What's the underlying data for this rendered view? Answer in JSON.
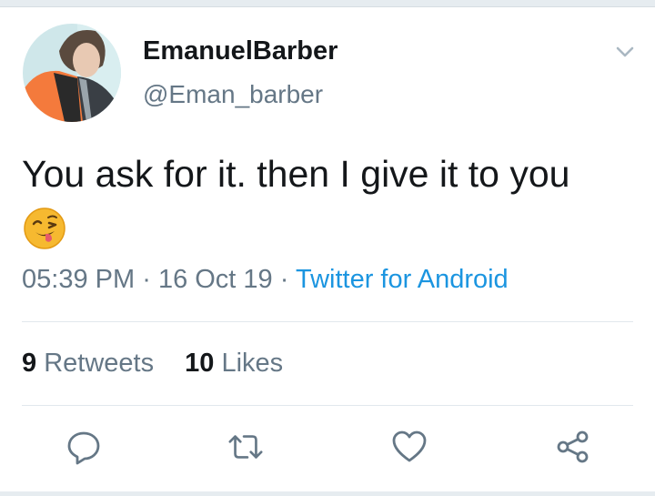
{
  "tweet": {
    "author": {
      "display_name": "EmanuelBarber",
      "handle": "@Eman_barber"
    },
    "text": "You ask for it. then I give it to you",
    "emoji": "winking-face-with-tongue",
    "time": "05:39 PM",
    "date": "16 Oct 19",
    "separator": "·",
    "source": "Twitter for Android",
    "stats": {
      "retweets_count": "9",
      "retweets_label": "Retweets",
      "likes_count": "10",
      "likes_label": "Likes"
    }
  },
  "icons": {
    "menu": "chevron-down-icon",
    "reply": "reply-icon",
    "retweet": "retweet-icon",
    "like": "heart-icon",
    "share": "share-icon"
  },
  "colors": {
    "text_primary": "#14171a",
    "text_secondary": "#657786",
    "link": "#1b95e0",
    "divider": "#e1e8ed"
  }
}
